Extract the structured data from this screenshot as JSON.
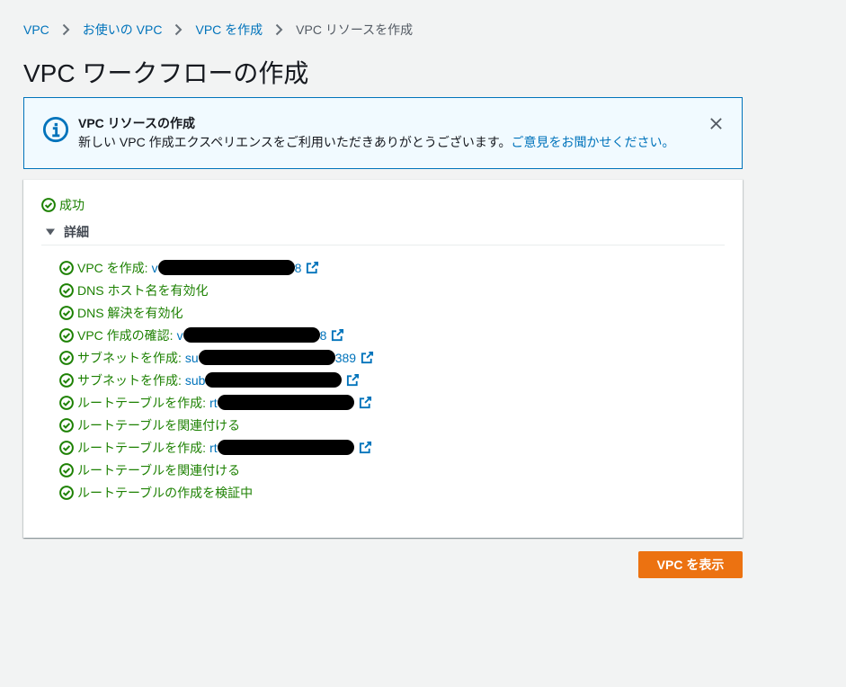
{
  "breadcrumb": {
    "items": [
      {
        "label": "VPC"
      },
      {
        "label": "お使いの VPC"
      },
      {
        "label": "VPC を作成"
      },
      {
        "label": "VPC リソースを作成"
      }
    ],
    "separator_icon": "chevron-right-icon"
  },
  "page_title": "VPC ワークフローの作成",
  "flash": {
    "icon": "info-icon",
    "title": "VPC リソースの作成",
    "message": "新しい VPC 作成エクスペリエンスをご利用いただきありがとうございます。",
    "feedback_link": "ご意見をお聞かせください。",
    "dismiss_icon": "close-icon"
  },
  "result": {
    "status_label": "成功",
    "status_icon": "status-success-icon"
  },
  "details": {
    "toggle_label": "詳細",
    "toggle_icon": "caret-down-icon",
    "expanded": true,
    "step_icon": "status-success-icon",
    "link_icon": "external-link-icon",
    "steps": [
      {
        "label": "VPC を作成:",
        "link": {
          "prefix": "v",
          "suffix": "8"
        }
      },
      {
        "label": "DNS ホスト名を有効化"
      },
      {
        "label": "DNS 解決を有効化"
      },
      {
        "label": "VPC 作成の確認:",
        "link": {
          "prefix": "v",
          "suffix": "8"
        }
      },
      {
        "label": "サブネットを作成:",
        "link": {
          "prefix": "su",
          "suffix": "389"
        }
      },
      {
        "label": "サブネットを作成:",
        "link": {
          "prefix": "sub"
        }
      },
      {
        "label": "ルートテーブルを作成:",
        "link": {
          "prefix": "rt"
        }
      },
      {
        "label": "ルートテーブルを関連付ける"
      },
      {
        "label": "ルートテーブルを作成:",
        "link": {
          "prefix": "rt"
        }
      },
      {
        "label": "ルートテーブルを関連付ける"
      },
      {
        "label": "ルートテーブルの作成を検証中"
      }
    ]
  },
  "actions": {
    "view_vpc_label": "VPC を表示"
  },
  "colors": {
    "background": "#f2f3f3",
    "link": "#0073bb",
    "success": "#1d8102",
    "info_background": "#f1faff",
    "info_border": "#0073bb",
    "primary_button": "#ec7211",
    "title_text": "#16191f",
    "secondary_text": "#545b64",
    "redaction": "#000000"
  }
}
